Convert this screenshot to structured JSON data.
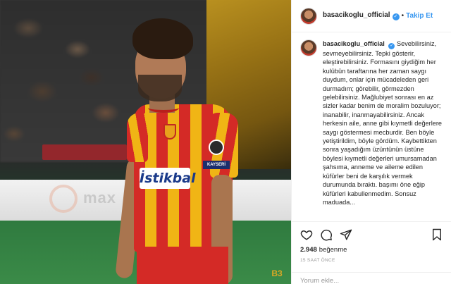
{
  "post": {
    "author": {
      "username": "basacikoglu_official",
      "verified_glyph": "✓"
    },
    "header": {
      "separator": "•",
      "follow_label": "Takip Et"
    },
    "caption": {
      "text": "Sevebilirsiniz, sevmeyebilirsiniz. Tepki gösterir, eleştirebilirsiniz. Formasını giydiğim her kulübün taraftarına her zaman saygı duydum, onlar için mücadeleden geri durmadım; görebilir, görmezden gelebilirsiniz. Mağlubiyet sonrası en az sizler kadar benim de moralim bozuluyor; inanabilir, inanmayabilirsiniz. Ancak herkesin aile, anne gibi kıymetli değerlere saygı göstermesi mecburdir. Ben böyle yetiştirildim, böyle gördüm. Kaybettikten sonra yaşadığım üzüntünün üstüne böylesi kıymetli değerleri umursamadan şahsıma, anneme ve aileme edilen küfürler beni de karşılık vermek durumunda bıraktı. başımı öne eğip küfürleri kabullenmedim. Sonsuz maduada..."
    },
    "photo": {
      "sponsor": "İstikbal",
      "ad_text": "max",
      "sleeve_text": "KAYSERİ",
      "watermark": "B3"
    },
    "actions": {
      "likes_count": "2.948",
      "likes_label": "beğenme"
    },
    "time_ago": "15 SAAT ÖNCE",
    "comment": {
      "placeholder": "Yorum ekle..."
    },
    "icons": [
      "heart-icon",
      "comment-icon",
      "share-icon",
      "bookmark-icon",
      "verified-badge-icon"
    ],
    "colors": {
      "link_blue": "#3897f0",
      "text": "#262626",
      "muted": "#999999",
      "jersey_red": "#d42a26",
      "jersey_yellow": "#f0b515"
    }
  }
}
